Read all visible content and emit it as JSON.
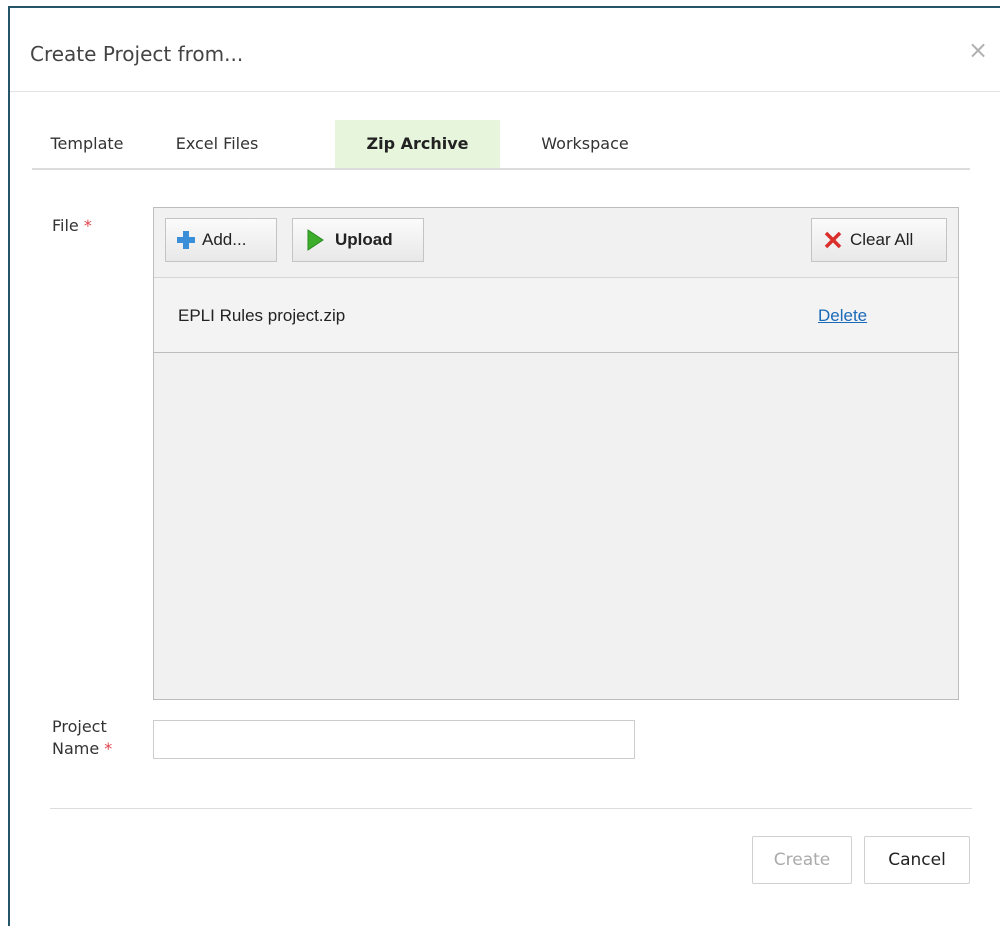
{
  "dialog": {
    "title": "Create Project from...",
    "close_label": "×"
  },
  "tabs": [
    {
      "label": "Template",
      "active": false
    },
    {
      "label": "Excel Files",
      "active": false
    },
    {
      "label": "Zip Archive",
      "active": true
    },
    {
      "label": "Workspace",
      "active": false
    }
  ],
  "file_field": {
    "label": "File",
    "required_mark": "*",
    "toolbar": {
      "add_label": "Add...",
      "upload_label": "Upload",
      "clear_all_label": "Clear All"
    },
    "files": [
      {
        "name": "EPLI Rules project.zip",
        "delete_label": "Delete"
      }
    ]
  },
  "project_name_field": {
    "label_line1": "Project",
    "label_line2": "Name",
    "required_mark": "*",
    "value": "",
    "placeholder": ""
  },
  "footer": {
    "create_label": "Create",
    "create_disabled": true,
    "cancel_label": "Cancel"
  },
  "colors": {
    "dialog_border": "#24556a",
    "active_tab_bg": "#e6f5dc",
    "required": "#e0414a",
    "link": "#1a6ab8",
    "add_icon": "#3a8fd8",
    "upload_icon": "#3cae2c",
    "clear_icon": "#d9302c"
  },
  "icons": {
    "add": "plus-icon",
    "upload": "play-arrow-icon",
    "clear_all": "x-icon",
    "close": "close-icon"
  }
}
